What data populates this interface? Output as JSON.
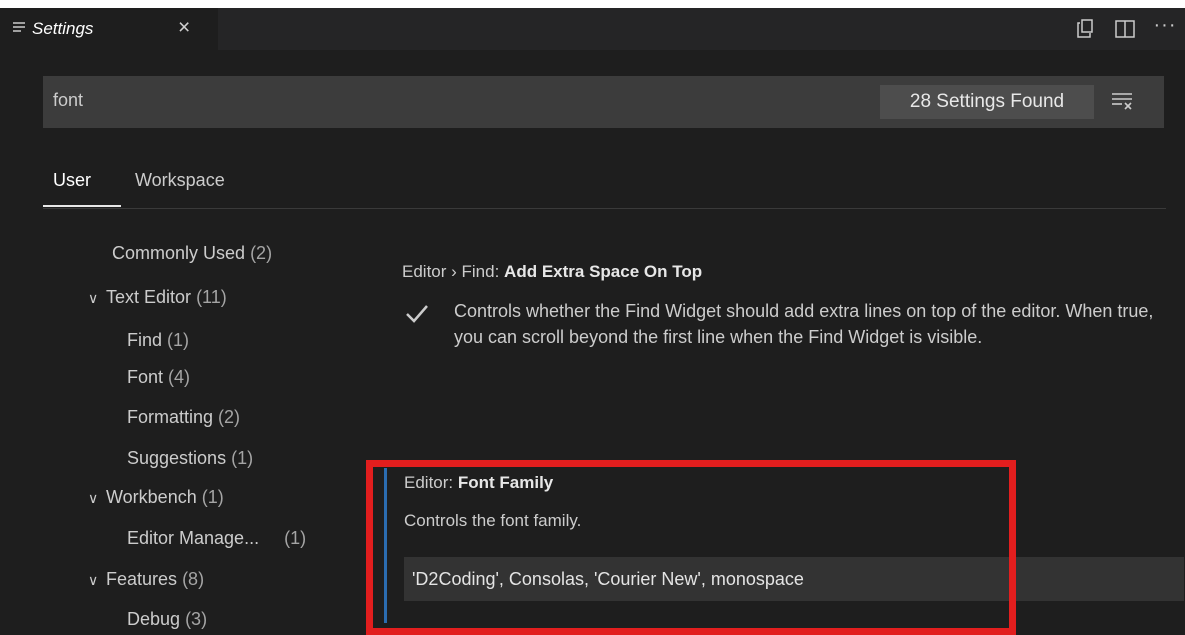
{
  "tab": {
    "title": "Settings",
    "close_glyph": "×",
    "icon": "settings-lines-icon"
  },
  "editor_actions": {
    "more_glyph": "···",
    "icons": [
      "open-json-icon",
      "split-editor-icon",
      "more-actions-icon"
    ]
  },
  "search": {
    "value": "font",
    "result_badge": "28 Settings Found",
    "clear_icon": "clear-filter-icon"
  },
  "scope_tabs": [
    {
      "label": "User",
      "active": true
    },
    {
      "label": "Workspace",
      "active": false
    }
  ],
  "toc": [
    {
      "label": "Commonly Used",
      "count": "(2)"
    },
    {
      "label": "Text Editor",
      "count": "(11)",
      "expanded": true
    },
    {
      "label": "Find",
      "count": "(1)"
    },
    {
      "label": "Font",
      "count": "(4)"
    },
    {
      "label": "Formatting",
      "count": "(2)"
    },
    {
      "label": "Suggestions",
      "count": "(1)"
    },
    {
      "label": "Workbench",
      "count": "(1)",
      "expanded": true
    },
    {
      "label": "Editor Manage...",
      "count": "(1)"
    },
    {
      "label": "Features",
      "count": "(8)",
      "expanded": true
    },
    {
      "label": "Debug",
      "count": "(3)"
    }
  ],
  "settings": [
    {
      "category": "Editor › Find: ",
      "name": "Add Extra Space On Top",
      "checked": true,
      "description": "Controls whether the Find Widget should add extra lines on top of the editor. When true, you can scroll beyond the first line when the Find Widget is visible."
    },
    {
      "category": "Editor: ",
      "name": "Font Family",
      "description": "Controls the font family.",
      "value": "'D2Coding', Consolas, 'Courier New', monospace"
    }
  ],
  "colors": {
    "highlight_border": "#e21e1e",
    "focus_bar": "#2b6cb0",
    "background": "#1e1e1e"
  }
}
